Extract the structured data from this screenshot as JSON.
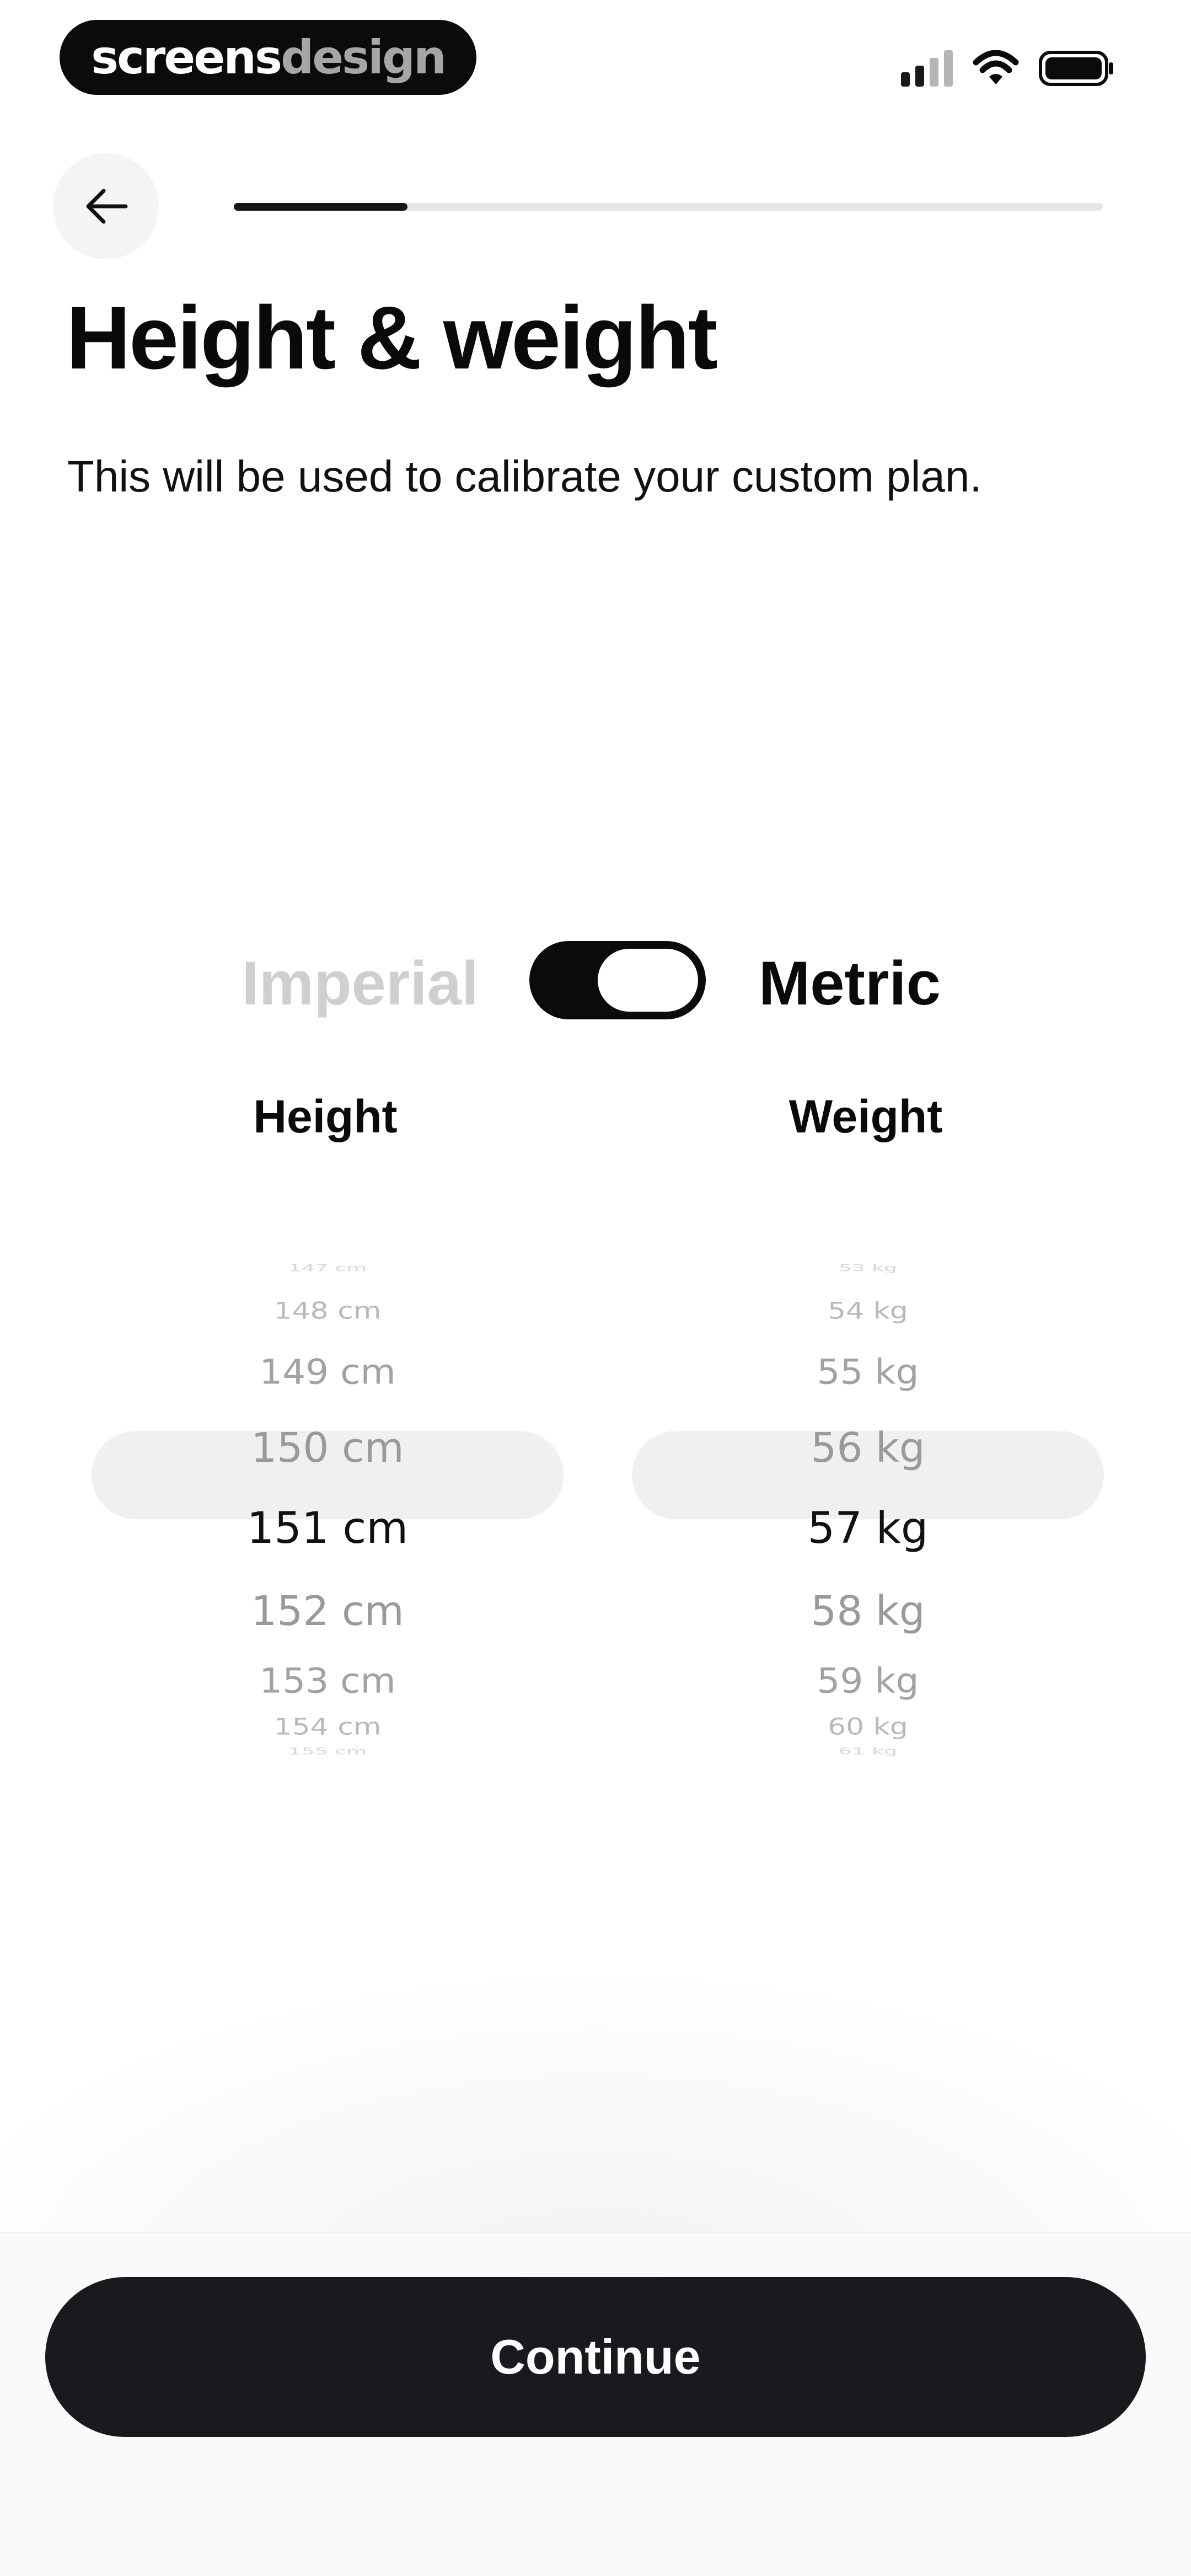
{
  "status_bar": {
    "brand_part1": "screens",
    "brand_part2": "design",
    "signal_colors": [
      "#1a1a1a",
      "#1a1a1a",
      "#b5b5b5",
      "#b5b5b5"
    ]
  },
  "nav": {
    "back_icon": "arrow-left-icon",
    "progress_fraction": 0.2
  },
  "header": {
    "title": "Height & weight",
    "subtitle": "This will be used to calibrate your custom plan."
  },
  "unit_toggle": {
    "left_label": "Imperial",
    "right_label": "Metric",
    "selected": "Metric"
  },
  "pickers": {
    "height": {
      "label": "Height",
      "items": [
        "147 cm",
        "148 cm",
        "149 cm",
        "150 cm",
        "151 cm",
        "152 cm",
        "153 cm",
        "154 cm",
        "155 cm"
      ],
      "selected": "151 cm"
    },
    "weight": {
      "label": "Weight",
      "items": [
        "53 kg",
        "54 kg",
        "55 kg",
        "56 kg",
        "57 kg",
        "58 kg",
        "59 kg",
        "60 kg",
        "61 kg"
      ],
      "selected": "57 kg"
    }
  },
  "footer": {
    "continue_label": "Continue"
  },
  "colors": {
    "primary": "#1b191e",
    "inactive_text": "#cfcfd1",
    "picker_highlight": "#f0f0f2",
    "progress_track": "#e6e6e8"
  }
}
